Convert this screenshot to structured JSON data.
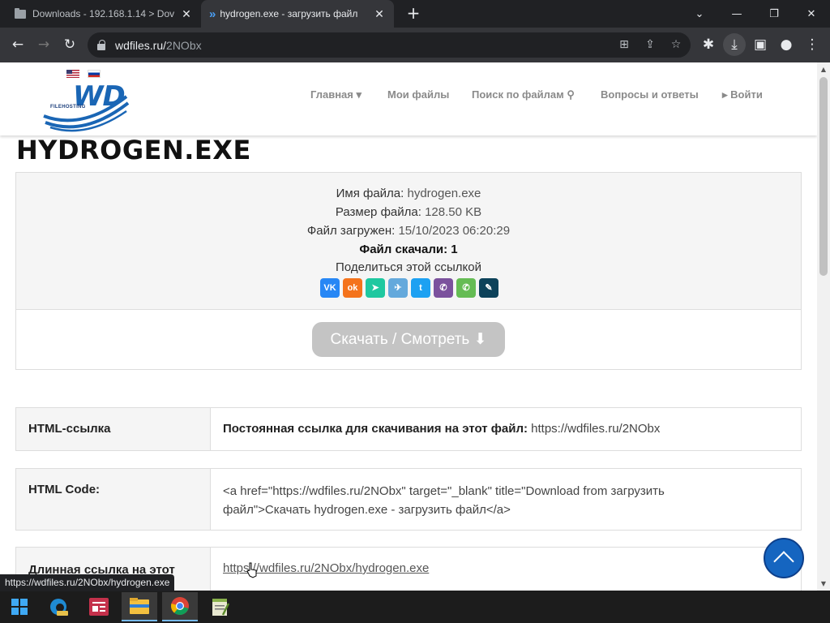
{
  "browser": {
    "tabs": [
      {
        "title": "Downloads - 192.168.1.14 > Dov",
        "active": false
      },
      {
        "title": "hydrogen.exe - загрузить файл",
        "active": true
      }
    ],
    "url_host": "wdfiles.ru/",
    "url_path": "2NObx",
    "status_url": "https://wdfiles.ru/2NObx/hydrogen.exe"
  },
  "site": {
    "logo_text": "WD",
    "logo_subtext": "FILEHOSTING",
    "nav": [
      {
        "label": "Главная ▾"
      },
      {
        "label": "Мои файлы"
      },
      {
        "label": "Поиск по файлам"
      },
      {
        "label": "Вопросы и ответы"
      },
      {
        "label": "▸ Войти"
      }
    ]
  },
  "file": {
    "title": "HYDROGEN.EXE",
    "name_label": "Имя файла:",
    "name_value": "hydrogen.exe",
    "size_label": "Размер файла:",
    "size_value": "128.50 KB",
    "uploaded_label": "Файл загружен:",
    "uploaded_value": "15/10/2023 06:20:29",
    "downloads_text": "Файл скачали: 1",
    "share_text": "Поделиться этой ссылкой",
    "download_button": "Скачать / Смотреть"
  },
  "share_icons": [
    {
      "name": "vk",
      "glyph": "VK",
      "color": "#2787f5"
    },
    {
      "name": "odnoklassniki",
      "glyph": "ok",
      "color": "#f4731c"
    },
    {
      "name": "send",
      "glyph": "➤",
      "color": "#1fc8a0"
    },
    {
      "name": "telegram",
      "glyph": "✈",
      "color": "#64a9dc"
    },
    {
      "name": "twitter",
      "glyph": "t",
      "color": "#1da1f2"
    },
    {
      "name": "viber",
      "glyph": "✆",
      "color": "#7b519d"
    },
    {
      "name": "whatsapp",
      "glyph": "✆",
      "color": "#65bc54"
    },
    {
      "name": "livejournal",
      "glyph": "✎",
      "color": "#0d425a"
    }
  ],
  "links": {
    "html_link_label": "HTML-ссылка",
    "html_link_bold": "Постоянная ссылка для скачивания на этот файл:",
    "html_link_value": "https://wdfiles.ru/2NObx",
    "html_code_label": "HTML Code:",
    "html_code_line1": "<a href=\"https://wdfiles.ru/2NObx\" target=\"_blank\" title=\"Download from загрузить",
    "html_code_line2": "файл\">Скачать hydrogen.exe - загрузить файл</a>",
    "long_link_label": "Длинная ссылка на этот",
    "long_link_value": "https://wdfiles.ru/2NObx/hydrogen.exe"
  }
}
